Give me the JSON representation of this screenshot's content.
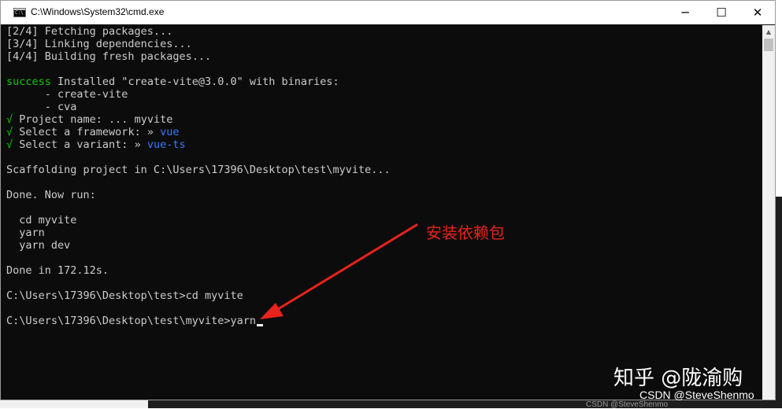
{
  "window": {
    "title": "C:\\Windows\\System32\\cmd.exe",
    "icon": "cmd-icon",
    "controls": {
      "minimize": "─",
      "maximize": "☐",
      "close": "✕"
    }
  },
  "console": {
    "lines": [
      "[2/4] Fetching packages...",
      "[3/4] Linking dependencies...",
      "[4/4] Building fresh packages...",
      "",
      {
        "success": "success",
        "rest": " Installed \"create-vite@3.0.0\" with binaries:"
      },
      "      - create-vite",
      "      - cva",
      {
        "check": "√",
        "rest": " Project name: ... myvite"
      },
      {
        "check": "√",
        "rest": " Select a framework: » ",
        "value": "vue"
      },
      {
        "check": "√",
        "rest": " Select a variant: » ",
        "value": "vue-ts"
      },
      "",
      "Scaffolding project in C:\\Users\\17396\\Desktop\\test\\myvite...",
      "",
      "Done. Now run:",
      "",
      "  cd myvite",
      "  yarn",
      "  yarn dev",
      "",
      "Done in 172.12s.",
      "",
      "C:\\Users\\17396\\Desktop\\test>cd myvite",
      "",
      {
        "prompt": "C:\\Users\\17396\\Desktop\\test\\myvite>yarn",
        "cursor": true
      }
    ]
  },
  "annotation": {
    "text": "安装依赖包",
    "color": "#e8231b"
  },
  "watermarks": {
    "zhihu": "知乎 @陇渝购",
    "csdn": "CSDN @SteveShenmo",
    "csdn_small": "CSDN @SteveShenmo"
  },
  "colors": {
    "console_bg": "#0c0c0c",
    "console_text": "#cccccc",
    "success": "#16c60c",
    "choice": "#3b78ff"
  }
}
